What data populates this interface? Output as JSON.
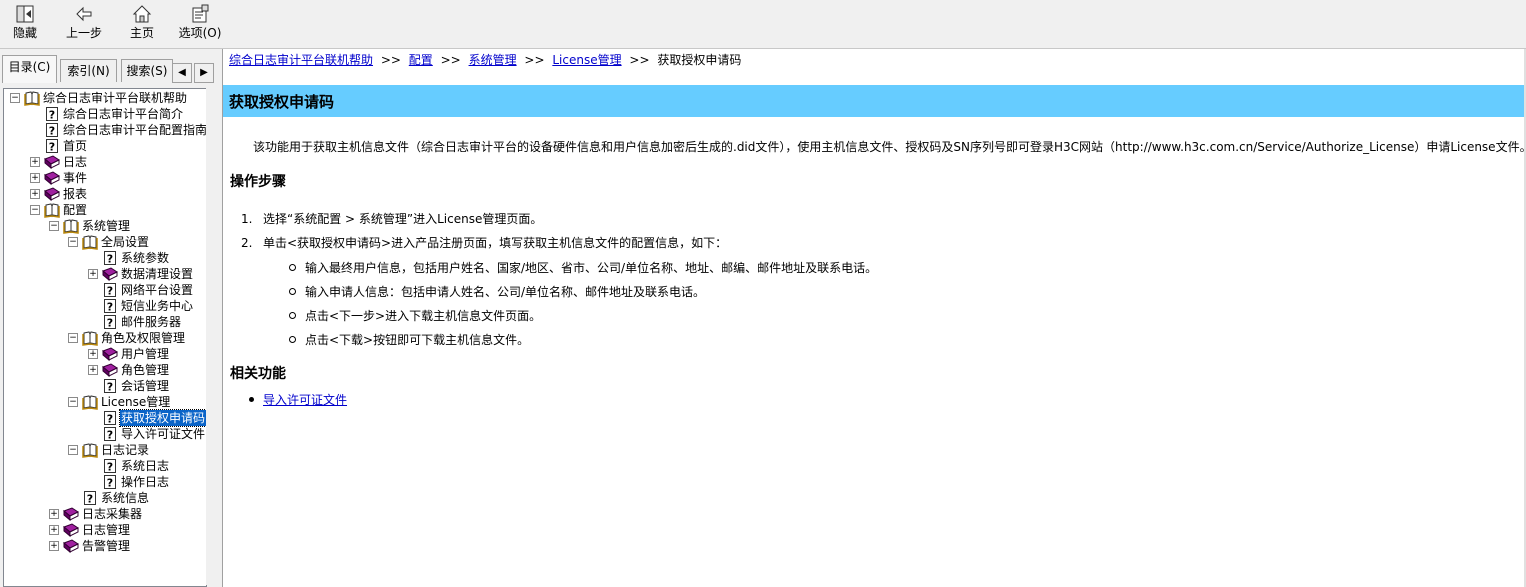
{
  "toolbar": {
    "buttons": [
      {
        "label": "隐藏",
        "icon": "hide-icon"
      },
      {
        "label": "上一步",
        "icon": "back-arrow-icon"
      },
      {
        "label": "主页",
        "icon": "home-icon"
      },
      {
        "label": "选项(O)",
        "icon": "options-icon"
      }
    ]
  },
  "tabs": [
    {
      "label": "目录(C)"
    },
    {
      "label": "索引(N)"
    },
    {
      "label": "搜索(S)"
    }
  ],
  "tab_arrows": {
    "left": "◀",
    "right": "▶"
  },
  "tree": [
    {
      "label": "综合日志审计平台联机帮助",
      "type": "openbook",
      "toggle": "−"
    },
    {
      "label": "综合日志审计平台简介",
      "type": "page"
    },
    {
      "label": "综合日志审计平台配置指南",
      "type": "page"
    },
    {
      "label": "首页",
      "type": "page"
    },
    {
      "label": "日志",
      "type": "book",
      "toggle": "+"
    },
    {
      "label": "事件",
      "type": "book",
      "toggle": "+"
    },
    {
      "label": "报表",
      "type": "book",
      "toggle": "+"
    },
    {
      "label": "配置",
      "type": "openbook",
      "toggle": "−"
    },
    {
      "label": "系统管理",
      "type": "openbook",
      "toggle": "−"
    },
    {
      "label": "全局设置",
      "type": "openbook",
      "toggle": "−"
    },
    {
      "label": "系统参数",
      "type": "page"
    },
    {
      "label": "数据清理设置",
      "type": "book",
      "toggle": "+"
    },
    {
      "label": "网络平台设置",
      "type": "page"
    },
    {
      "label": "短信业务中心",
      "type": "page"
    },
    {
      "label": "邮件服务器",
      "type": "page"
    },
    {
      "label": "角色及权限管理",
      "type": "openbook",
      "toggle": "−"
    },
    {
      "label": "用户管理",
      "type": "book",
      "toggle": "+"
    },
    {
      "label": "角色管理",
      "type": "book",
      "toggle": "+"
    },
    {
      "label": "会话管理",
      "type": "page"
    },
    {
      "label": "License管理",
      "type": "openbook",
      "toggle": "−"
    },
    {
      "label": "获取授权申请码",
      "type": "page",
      "selected": true
    },
    {
      "label": "导入许可证文件",
      "type": "page"
    },
    {
      "label": "日志记录",
      "type": "openbook",
      "toggle": "−"
    },
    {
      "label": "系统日志",
      "type": "page"
    },
    {
      "label": "操作日志",
      "type": "page"
    },
    {
      "label": "系统信息",
      "type": "page"
    },
    {
      "label": "日志采集器",
      "type": "book",
      "toggle": "+"
    },
    {
      "label": "日志管理",
      "type": "book",
      "toggle": "+"
    },
    {
      "label": "告警管理",
      "type": "book",
      "toggle": "+"
    }
  ],
  "breadcrumb": {
    "items": [
      "综合日志审计平台联机帮助",
      "配置",
      "系统管理",
      "License管理"
    ],
    "separator": ">>",
    "current": "获取授权申请码"
  },
  "content": {
    "title": "获取授权申请码",
    "intro": "该功能用于获取主机信息文件（综合日志审计平台的设备硬件信息和用户信息加密后生成的.did文件），使用主机信息文件、授权码及SN序列号即可登录H3C网站（http://www.h3c.com.cn/Service/Authorize_License）申请License文件。",
    "steps_heading": "操作步骤",
    "steps": [
      {
        "num": "1.",
        "text": "选择“系统配置 > 系统管理”进入License管理页面。"
      },
      {
        "num": "2.",
        "text": "单击<获取授权申请码>进入产品注册页面，填写获取主机信息文件的配置信息，如下："
      }
    ],
    "substeps": [
      "输入最终用户信息，包括用户姓名、国家/地区、省市、公司/单位名称、地址、邮编、邮件地址及联系电话。",
      "输入申请人信息：包括申请人姓名、公司/单位名称、邮件地址及联系电话。",
      "点击<下一步>进入下载主机信息文件页面。",
      "点击<下载>按钮即可下载主机信息文件。"
    ],
    "related_heading": "相关功能",
    "related_links": [
      "导入许可证文件"
    ]
  },
  "colors": {
    "title_bar": "#66ccff",
    "link": "#0000cc",
    "selection": "#0a64c8",
    "book_purple": "#800080"
  }
}
